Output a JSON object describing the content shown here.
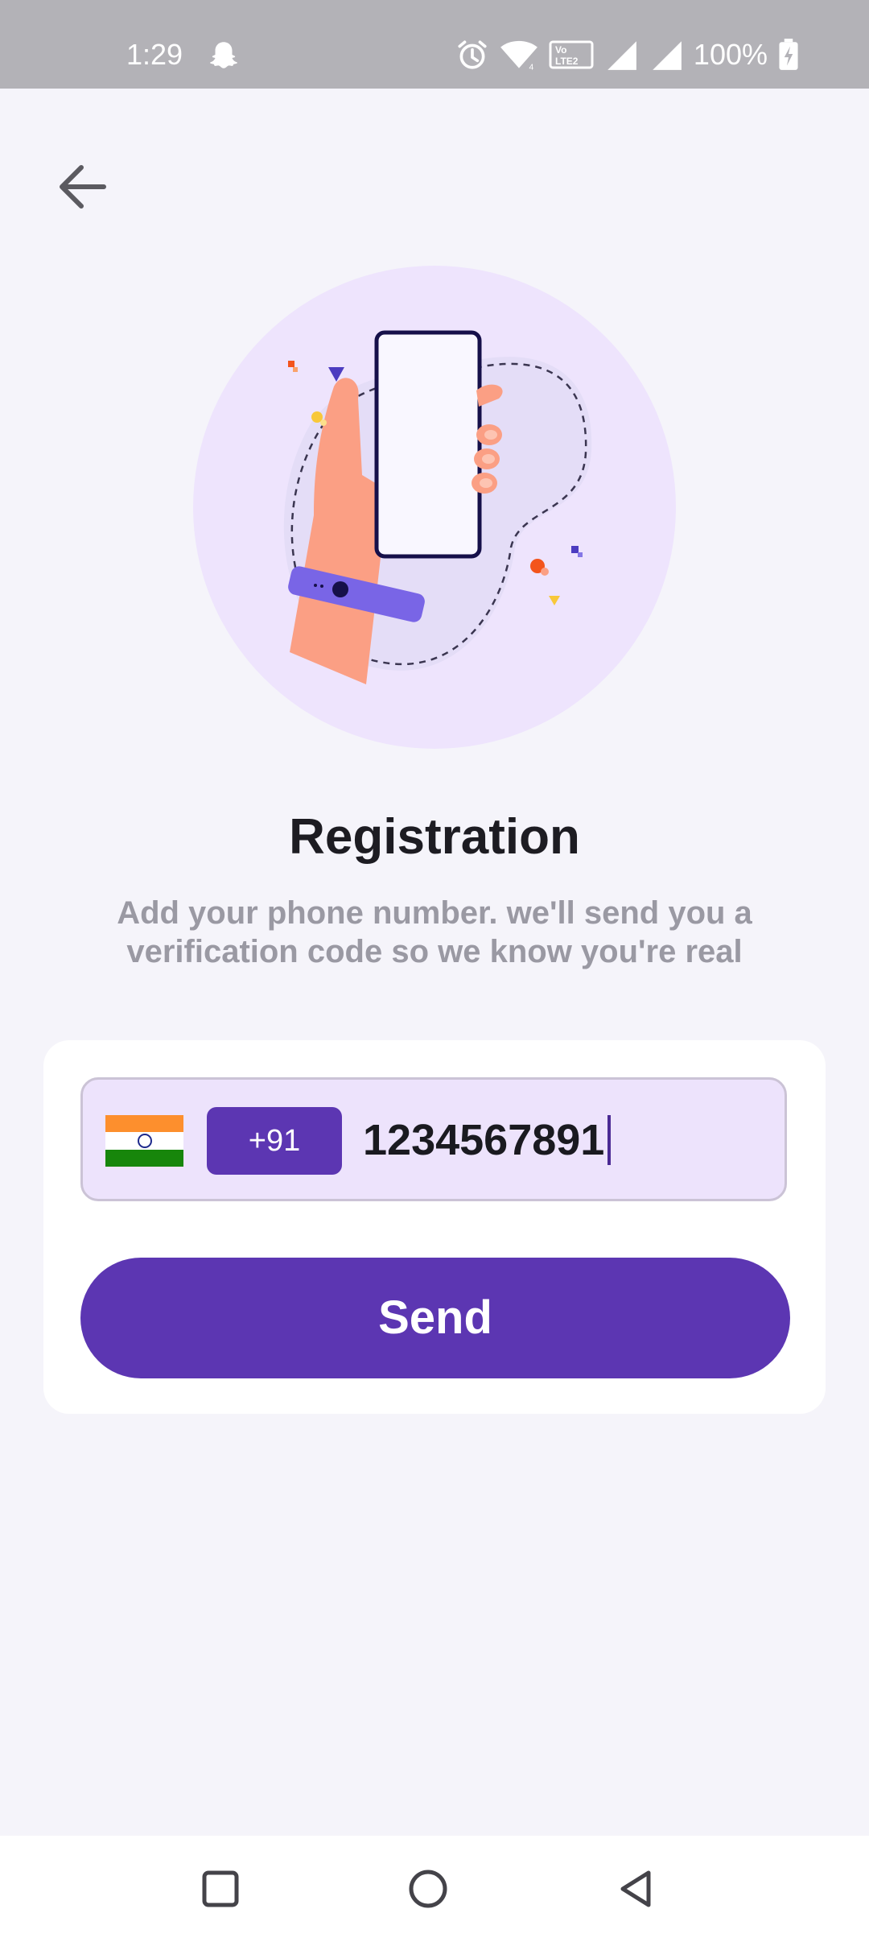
{
  "status_bar": {
    "time": "1:29",
    "battery": "100%",
    "icons": [
      "snapchat-icon",
      "alarm-icon",
      "wifi-icon",
      "volte-icon",
      "signal-icon",
      "signal-icon",
      "battery-charging-icon"
    ]
  },
  "header": {
    "back_icon": "arrow-left-icon"
  },
  "main": {
    "title": "Registration",
    "subtitle": "Add your phone number. we'll send you a verification code so we know you're real"
  },
  "form": {
    "country_flag": "india-flag-icon",
    "country_code": "+91",
    "phone_value": "1234567891",
    "send_label": "Send"
  },
  "nav_bar": {
    "items": [
      "recents-icon",
      "home-icon",
      "back-icon"
    ]
  },
  "colors": {
    "accent": "#5c36b2",
    "field_bg": "#ede3fc",
    "page_bg": "#f5f4fa",
    "status_bar": "#b3b2b7"
  }
}
